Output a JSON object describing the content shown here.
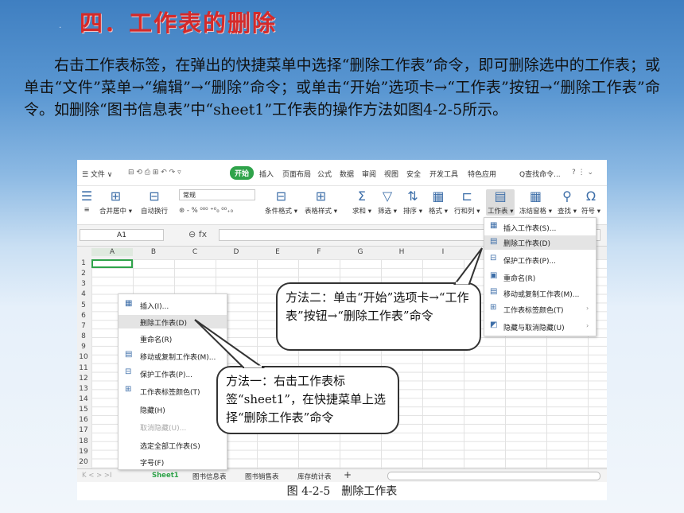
{
  "page": {
    "title": "四．工作表的删除",
    "bullet": "·",
    "paragraph": "右击工作表标签，在弹出的快捷菜单中选择“删除工作表”命令，即可删除选中的工作表；或单击“文件”菜单→“编辑”→“删除”命令；或单击“开始”选项卡→“工作表”按钮→“删除工作表”命令。如删除“图书信息表”中“sheet1”工作表的操作方法如图4-2-5所示。",
    "caption": "图 4-2-5　删除工作表"
  },
  "menubar": {
    "file": "☰ 文件 ∨",
    "quick_icons": "⊟ ⟲ ⎙ ⊞ ↶ ↷ ▿",
    "tabs": [
      "开始",
      "插入",
      "页面布局",
      "公式",
      "数据",
      "审阅",
      "视图",
      "安全",
      "开发工具",
      "特色应用"
    ],
    "search": "Q查找命令...",
    "help": "?  ⋮  ⌄"
  },
  "ribbon": {
    "merge": "合并居中",
    "wrap": "自动换行",
    "format_combo": "常规",
    "number_fmt": "⊛ - %  ⁰⁰⁰  ⁺⁰₀  ⁰⁰₊₀",
    "cond_fmt": "条件格式",
    "table_style": "表格样式",
    "sum": "求和",
    "filter": "筛选",
    "sort": "排序",
    "format": "格式",
    "rowcol": "行和列",
    "worksheet": "工作表",
    "freeze": "冻结窗格",
    "find": "查找",
    "symbol": "符号"
  },
  "formula_bar": {
    "namebox": "A1",
    "fx": "⊖  fx"
  },
  "columns": [
    "A",
    "B",
    "C",
    "D",
    "E",
    "F",
    "G",
    "H",
    "I"
  ],
  "rows": [
    "1",
    "2",
    "3",
    "4",
    "5",
    "6",
    "7",
    "8",
    "9",
    "10",
    "11",
    "12",
    "13",
    "14",
    "15",
    "16",
    "17",
    "18",
    "19",
    "20"
  ],
  "sheet_tabs": [
    "Sheet1",
    "图书信息表",
    "图书销售表",
    "库存统计表"
  ],
  "sheet_nav": "K  <  >  >I",
  "context_menu": {
    "items": [
      "插入(I)...",
      "删除工作表(D)",
      "重命名(R)",
      "移动或复制工作表(M)...",
      "保护工作表(P)...",
      "工作表标签颜色(T)",
      "隐藏(H)",
      "取消隐藏(U)...",
      "选定全部工作表(S)",
      "字号(F)"
    ]
  },
  "worksheet_menu": {
    "items": [
      "插入工作表(S)...",
      "删除工作表(D)",
      "保护工作表(P)...",
      "重命名(R)",
      "移动或复制工作表(M)...",
      "工作表标签颜色(T)",
      "隐藏与取消隐藏(U)"
    ]
  },
  "callouts": {
    "method2": "方法二：单击“开始”选项卡→“工作表”按钮→“删除工作表”命令",
    "method1": "方法一：右击工作表标签“sheet1”，在快捷菜单上选择“删除工作表”命令"
  }
}
